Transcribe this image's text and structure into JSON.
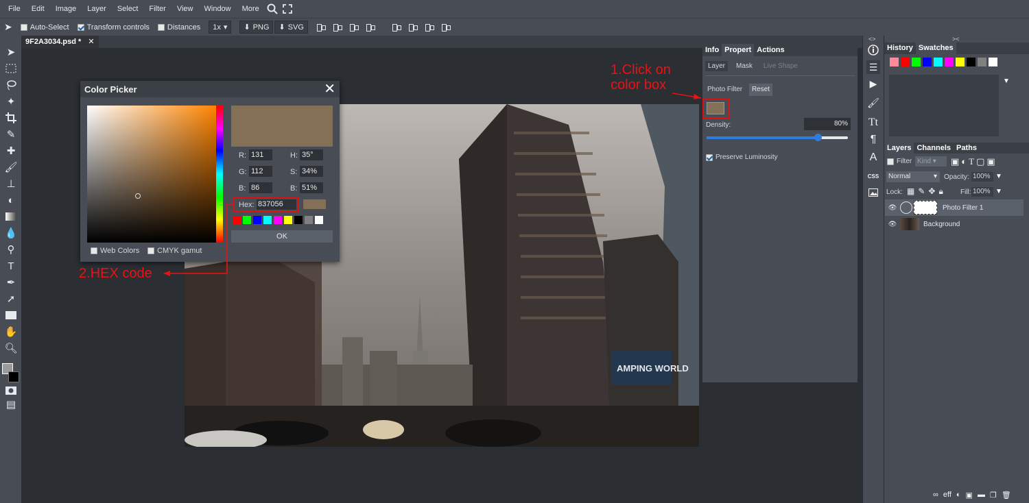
{
  "menu": {
    "items": [
      "File",
      "Edit",
      "Image",
      "Layer",
      "Select",
      "Filter",
      "View",
      "Window",
      "More"
    ]
  },
  "options": {
    "auto_select": "Auto-Select",
    "transform_controls": "Transform controls",
    "distances": "Distances",
    "scale": "1x",
    "png": "PNG",
    "svg": "SVG"
  },
  "document": {
    "tab_title": "9F2A3034.psd *",
    "photo_sign_text": "AMPING WORLD"
  },
  "color_picker": {
    "title": "Color Picker",
    "r_label": "R:",
    "r": "131",
    "g_label": "G:",
    "g": "112",
    "b_label": "B:",
    "b": "86",
    "h_label": "H:",
    "h": "35°",
    "s_label": "S:",
    "s": "34%",
    "bb_label": "B:",
    "bv": "51%",
    "hex_label": "Hex:",
    "hex": "837056",
    "web_colors": "Web Colors",
    "cmyk_gamut": "CMYK gamut",
    "ok": "OK",
    "current_color": "#837056",
    "swatches": [
      "#ff0000",
      "#00ff00",
      "#0000ff",
      "#00ffff",
      "#ff00ff",
      "#ffff00",
      "#000000",
      "#808080",
      "#ffffff"
    ]
  },
  "annotations": {
    "step1_line1": "1.Click on",
    "step1_line2": "color box",
    "step2": "2.HEX code"
  },
  "properties": {
    "tabs": [
      "Info",
      "Propert",
      "Actions"
    ],
    "subtabs": [
      "Layer",
      "Mask",
      "Live Shape"
    ],
    "filter_label": "Photo Filter",
    "reset": "Reset",
    "density_label": "Density:",
    "density_value": "80%",
    "preserve_luminosity": "Preserve Luminosity"
  },
  "history": {
    "tabs": [
      "History",
      "Swatches"
    ],
    "swatches": [
      "#ff8a9a",
      "#ff0000",
      "#00ff00",
      "#0000ff",
      "#00ffff",
      "#ff00ff",
      "#ffff00",
      "#000000",
      "#808080",
      "#ffffff"
    ]
  },
  "layers": {
    "tabs": [
      "Layers",
      "Channels",
      "Paths"
    ],
    "filter_label": "Filter",
    "kind": "Kind",
    "blend_mode": "Normal",
    "opacity_label": "Opacity:",
    "opacity": "100%",
    "lock_label": "Lock:",
    "fill_label": "Fill:",
    "fill": "100%",
    "items": [
      "Photo Filter 1",
      "Background"
    ],
    "bottom_eff": "eff"
  },
  "midcol": {
    "css_label": "CSS"
  }
}
